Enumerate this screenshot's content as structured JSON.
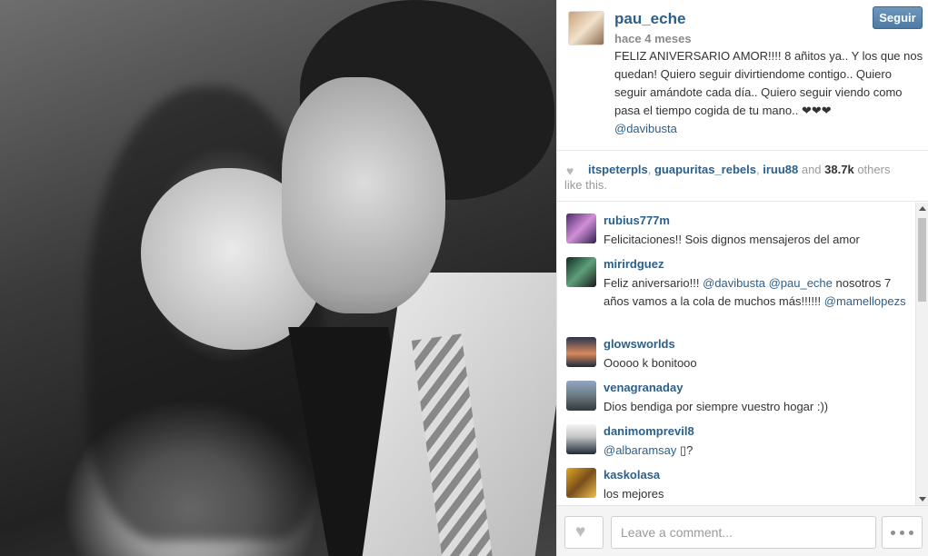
{
  "post": {
    "username": "pau_eche",
    "time": "hace 4 meses",
    "follow_label": "Seguir",
    "caption_text": "FELIZ ANIVERSARIO AMOR!!!! 8 añitos ya.. Y los que nos quedan! Quiero seguir divirtiendome contigo.. Quiero seguir amándote cada día.. Quiero seguir viendo como pasa el tiempo cogida de tu mano.. ❤❤❤",
    "caption_mention": "@davibusta"
  },
  "likes": {
    "user1": "itspeterpls",
    "sep1": ", ",
    "user2": "guapuritas_rebels",
    "sep2": ", ",
    "user3": "iruu88",
    "and": " and ",
    "count": "38.7k",
    "others": " others",
    "line2": "like this."
  },
  "comments": [
    {
      "user": "rubius777m",
      "text": "Felicitaciones!! Sois dignos mensajeros del amor"
    },
    {
      "user": "mirirdguez",
      "text_a": "Feliz aniversario!!! ",
      "mention1": "@davibusta",
      "sp": " ",
      "mention2": "@pau_eche",
      "text_b": " nosotros 7 años vamos a la cola de muchos más!!!!!! ",
      "mention3": "@mamellopezs"
    },
    {
      "user": "glowsworlds",
      "text": "Ooooo k bonitooo"
    },
    {
      "user": "venagranaday",
      "text": "Dios bendiga por siempre vuestro hogar :))"
    },
    {
      "user": "danimomprevil8",
      "mention": "@albaramsay",
      "text": " ▯?"
    },
    {
      "user": "kaskolasa",
      "text": "los mejores"
    }
  ],
  "footer": {
    "comment_placeholder": "Leave a comment..."
  },
  "icons": {
    "heart": "heart-icon",
    "more": "more-dots-icon"
  },
  "colors": {
    "link": "#2c5f8a",
    "follow_button": "#4d7aa4"
  }
}
